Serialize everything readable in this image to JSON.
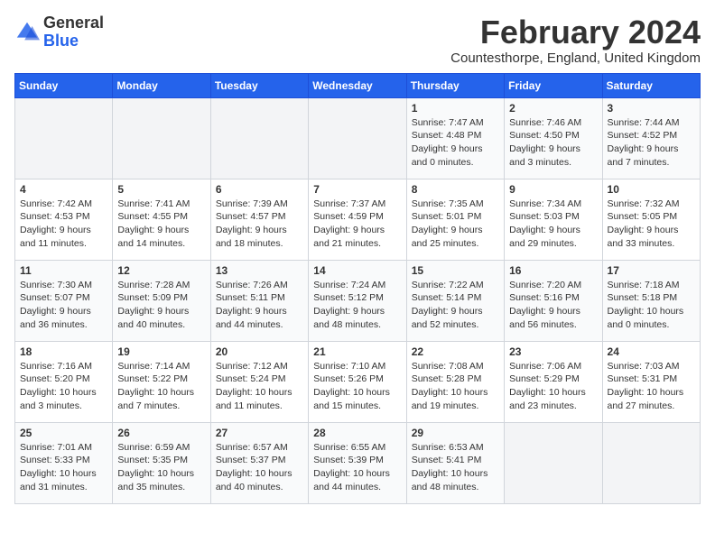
{
  "logo": {
    "general": "General",
    "blue": "Blue"
  },
  "title": "February 2024",
  "subtitle": "Countesthorpe, England, United Kingdom",
  "header": {
    "days": [
      "Sunday",
      "Monday",
      "Tuesday",
      "Wednesday",
      "Thursday",
      "Friday",
      "Saturday"
    ]
  },
  "weeks": [
    [
      {
        "date": "",
        "info": ""
      },
      {
        "date": "",
        "info": ""
      },
      {
        "date": "",
        "info": ""
      },
      {
        "date": "",
        "info": ""
      },
      {
        "date": "1",
        "info": "Sunrise: 7:47 AM\nSunset: 4:48 PM\nDaylight: 9 hours and 0 minutes."
      },
      {
        "date": "2",
        "info": "Sunrise: 7:46 AM\nSunset: 4:50 PM\nDaylight: 9 hours and 3 minutes."
      },
      {
        "date": "3",
        "info": "Sunrise: 7:44 AM\nSunset: 4:52 PM\nDaylight: 9 hours and 7 minutes."
      }
    ],
    [
      {
        "date": "4",
        "info": "Sunrise: 7:42 AM\nSunset: 4:53 PM\nDaylight: 9 hours and 11 minutes."
      },
      {
        "date": "5",
        "info": "Sunrise: 7:41 AM\nSunset: 4:55 PM\nDaylight: 9 hours and 14 minutes."
      },
      {
        "date": "6",
        "info": "Sunrise: 7:39 AM\nSunset: 4:57 PM\nDaylight: 9 hours and 18 minutes."
      },
      {
        "date": "7",
        "info": "Sunrise: 7:37 AM\nSunset: 4:59 PM\nDaylight: 9 hours and 21 minutes."
      },
      {
        "date": "8",
        "info": "Sunrise: 7:35 AM\nSunset: 5:01 PM\nDaylight: 9 hours and 25 minutes."
      },
      {
        "date": "9",
        "info": "Sunrise: 7:34 AM\nSunset: 5:03 PM\nDaylight: 9 hours and 29 minutes."
      },
      {
        "date": "10",
        "info": "Sunrise: 7:32 AM\nSunset: 5:05 PM\nDaylight: 9 hours and 33 minutes."
      }
    ],
    [
      {
        "date": "11",
        "info": "Sunrise: 7:30 AM\nSunset: 5:07 PM\nDaylight: 9 hours and 36 minutes."
      },
      {
        "date": "12",
        "info": "Sunrise: 7:28 AM\nSunset: 5:09 PM\nDaylight: 9 hours and 40 minutes."
      },
      {
        "date": "13",
        "info": "Sunrise: 7:26 AM\nSunset: 5:11 PM\nDaylight: 9 hours and 44 minutes."
      },
      {
        "date": "14",
        "info": "Sunrise: 7:24 AM\nSunset: 5:12 PM\nDaylight: 9 hours and 48 minutes."
      },
      {
        "date": "15",
        "info": "Sunrise: 7:22 AM\nSunset: 5:14 PM\nDaylight: 9 hours and 52 minutes."
      },
      {
        "date": "16",
        "info": "Sunrise: 7:20 AM\nSunset: 5:16 PM\nDaylight: 9 hours and 56 minutes."
      },
      {
        "date": "17",
        "info": "Sunrise: 7:18 AM\nSunset: 5:18 PM\nDaylight: 10 hours and 0 minutes."
      }
    ],
    [
      {
        "date": "18",
        "info": "Sunrise: 7:16 AM\nSunset: 5:20 PM\nDaylight: 10 hours and 3 minutes."
      },
      {
        "date": "19",
        "info": "Sunrise: 7:14 AM\nSunset: 5:22 PM\nDaylight: 10 hours and 7 minutes."
      },
      {
        "date": "20",
        "info": "Sunrise: 7:12 AM\nSunset: 5:24 PM\nDaylight: 10 hours and 11 minutes."
      },
      {
        "date": "21",
        "info": "Sunrise: 7:10 AM\nSunset: 5:26 PM\nDaylight: 10 hours and 15 minutes."
      },
      {
        "date": "22",
        "info": "Sunrise: 7:08 AM\nSunset: 5:28 PM\nDaylight: 10 hours and 19 minutes."
      },
      {
        "date": "23",
        "info": "Sunrise: 7:06 AM\nSunset: 5:29 PM\nDaylight: 10 hours and 23 minutes."
      },
      {
        "date": "24",
        "info": "Sunrise: 7:03 AM\nSunset: 5:31 PM\nDaylight: 10 hours and 27 minutes."
      }
    ],
    [
      {
        "date": "25",
        "info": "Sunrise: 7:01 AM\nSunset: 5:33 PM\nDaylight: 10 hours and 31 minutes."
      },
      {
        "date": "26",
        "info": "Sunrise: 6:59 AM\nSunset: 5:35 PM\nDaylight: 10 hours and 35 minutes."
      },
      {
        "date": "27",
        "info": "Sunrise: 6:57 AM\nSunset: 5:37 PM\nDaylight: 10 hours and 40 minutes."
      },
      {
        "date": "28",
        "info": "Sunrise: 6:55 AM\nSunset: 5:39 PM\nDaylight: 10 hours and 44 minutes."
      },
      {
        "date": "29",
        "info": "Sunrise: 6:53 AM\nSunset: 5:41 PM\nDaylight: 10 hours and 48 minutes."
      },
      {
        "date": "",
        "info": ""
      },
      {
        "date": "",
        "info": ""
      }
    ]
  ]
}
